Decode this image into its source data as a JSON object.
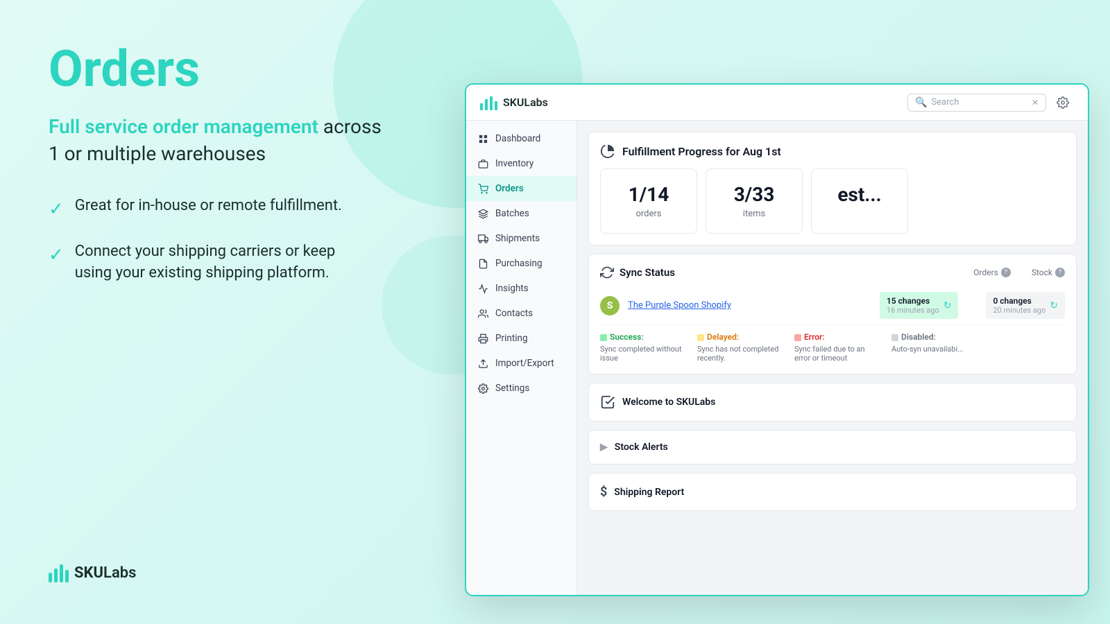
{
  "marketing": {
    "title": "Orders",
    "subtitle_highlight": "Full service order management",
    "subtitle_rest": " across\n1 or multiple warehouses",
    "features": [
      "Great for in-house or remote fulfillment.",
      "Connect your shipping carriers or keep using your existing shipping platform."
    ],
    "logo_text_sku": "SKU",
    "logo_text_labs": "Labs"
  },
  "app": {
    "header": {
      "logo_sku": "SKU",
      "logo_labs": "Labs",
      "search_placeholder": "Search"
    },
    "sidebar": {
      "items": [
        {
          "id": "dashboard",
          "label": "Dashboard",
          "icon": "grid"
        },
        {
          "id": "inventory",
          "label": "Inventory",
          "icon": "box"
        },
        {
          "id": "orders",
          "label": "Orders",
          "icon": "shopping-cart",
          "active": true
        },
        {
          "id": "batches",
          "label": "Batches",
          "icon": "layers"
        },
        {
          "id": "shipments",
          "label": "Shipments",
          "icon": "truck"
        },
        {
          "id": "purchasing",
          "label": "Purchasing",
          "icon": "file"
        },
        {
          "id": "insights",
          "label": "Insights",
          "icon": "bar-chart"
        },
        {
          "id": "contacts",
          "label": "Contacts",
          "icon": "users"
        },
        {
          "id": "printing",
          "label": "Printing",
          "icon": "printer"
        },
        {
          "id": "import-export",
          "label": "Import/Export",
          "icon": "upload"
        },
        {
          "id": "settings",
          "label": "Settings",
          "icon": "gear"
        }
      ]
    },
    "main": {
      "fulfillment": {
        "title": "Fulfillment Progress for Aug 1st",
        "stats": [
          {
            "number": "1/14",
            "label": "orders"
          },
          {
            "number": "3/33",
            "label": "items"
          }
        ]
      },
      "sync": {
        "title": "Sync Status",
        "orders_label": "Orders",
        "stock_label": "Stock",
        "store_name": "The Purple Spoon Shopify",
        "orders_changes": "15 changes",
        "orders_time": "16 minutes ago",
        "stock_changes": "0 changes",
        "stock_time": "20 minutes ago",
        "legend": [
          {
            "color": "#86efac",
            "label": "Success:",
            "desc": "Sync completed without issue"
          },
          {
            "color": "#fde68a",
            "label": "Delayed:",
            "desc": "Sync has not completed recently."
          },
          {
            "color": "#fca5a5",
            "label": "Error:",
            "desc": "Sync failed due to an error or timeout"
          },
          {
            "color": "#d1d5db",
            "label": "Disabled:",
            "desc": "Auto-syn unavailabi..."
          }
        ]
      },
      "welcome_title": "Welcome to SKULabs",
      "stock_alerts_title": "Stock Alerts",
      "shipping_report_title": "Shipping Report"
    }
  }
}
